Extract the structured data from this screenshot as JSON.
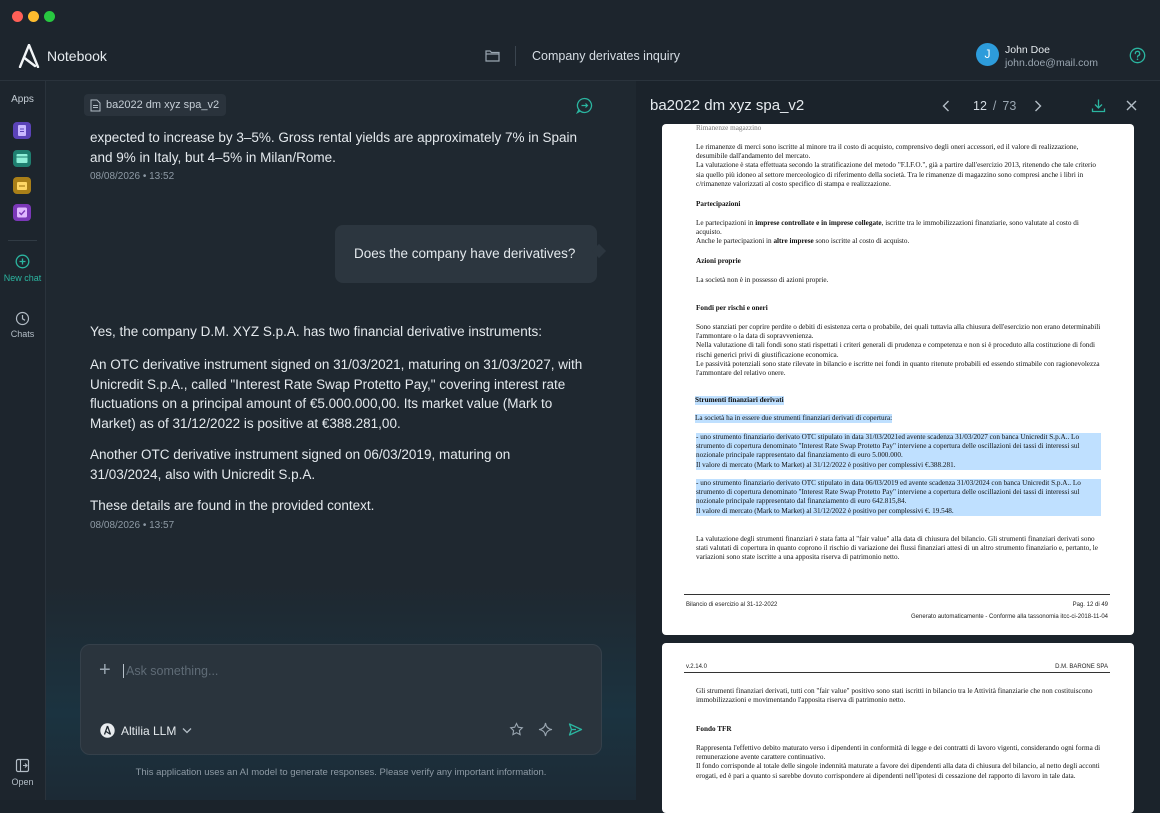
{
  "header": {
    "app_name": "Notebook",
    "document_title": "Company derivates inquiry",
    "user": {
      "initial": "J",
      "name": "John Doe",
      "email": "john.doe@mail.com"
    }
  },
  "sidebar": {
    "apps_label": "Apps",
    "new_chat_label": "New chat",
    "chats_label": "Chats",
    "open_label": "Open"
  },
  "chat": {
    "source_chip": "ba2022 dm xyz spa_v2",
    "messages": {
      "assistant_partial": "expected to increase by 3–5%. Gross rental yields are approximately 7% in Spain and 9% in Italy, but 4–5% in Milan/Rome.",
      "assistant_partial_time": "08/08/2026 • 13:52",
      "user_question": "Does the company have derivatives?",
      "answer_intro": "Yes, the company D.M. XYZ S.p.A. has two financial derivative instruments:",
      "answer_item1": " An OTC derivative instrument signed on 31/03/2021, maturing on 31/03/2027, with Unicredit S.p.A., called \"Interest Rate Swap Protetto Pay,\" covering interest rate fluctuations on a principal amount of €5.000.000,00. Its market value (Mark to Market) as of 31/12/2022 is positive at €388.281,00.",
      "answer_item2": "Another OTC derivative instrument signed on 06/03/2019, maturing on 31/03/2024, also with Unicredit S.p.A.",
      "answer_outro": "These details are found in the provided context.",
      "answer_time": "08/08/2026 • 13:57"
    },
    "input_placeholder": "Ask something...",
    "model_name": "Altilia LLM",
    "disclaimer": "This application uses an AI model to generate responses. Please verify any important information."
  },
  "document": {
    "title": "ba2022 dm xyz spa_v2",
    "current_page": "12",
    "page_separator": "/",
    "total_pages": "73",
    "page1": {
      "top_cut": "Rimanenze magazzino",
      "rimanenze": "Le rimanenze di merci sono iscritte al minore tra il costo di acquisto, comprensivo degli oneri accessori, ed il valore di realizzazione, desumibile dall'andamento del mercato.",
      "rimanenze2": "La valutazione è stata effettuata secondo la stratificazione del metodo \"F.I.F.O.\", già a partire dall'esercizio 2013, ritenendo che tale criterio sia quello più idoneo al settore merceologico di riferimento della società. Tra le rimanenze di magazzino sono compresi anche i libri in c/rimanenze valorizzati al costo specifico di stampa e realizzazione.",
      "partecipazioni_h": "Partecipazioni",
      "partecipazioni_a": "Le partecipazioni in ",
      "partecipazioni_b": "imprese controllate e in imprese collegate",
      "partecipazioni_c": ", iscritte tra le immobilizzazioni finanziarie, sono valutate al costo di acquisto.",
      "partecipazioni2_a": "Anche le partecipazioni in ",
      "partecipazioni2_b": "altre imprese",
      "partecipazioni2_c": " sono iscritte al costo di acquisto.",
      "azioni_h": "Azioni proprie",
      "azioni": "La società non è in possesso di azioni proprie.",
      "fondi_h": "Fondi per rischi e oneri",
      "fondi1": "Sono stanziati per coprire perdite o debiti di esistenza certa o probabile, dei quali tuttavia alla chiusura dell'esercizio non erano determinabili l'ammontare o la data di sopravvenienza.",
      "fondi2": "Nella valutazione di tali fondi sono stati rispettati i criteri generali di prudenza e competenza e non si è proceduto alla costituzione di fondi rischi generici privi di giustificazione economica.",
      "fondi3": "Le passività potenziali sono state rilevate in bilancio e iscritte nei fondi in quanto ritenute probabili ed essendo stimabile con ragionevolezza l'ammontare del relativo onere.",
      "strumenti_h": "Strumenti finanziari derivati",
      "strumenti_intro": "La società ha  in essere due strumenti finanziari derivati di copertura:",
      "strumento1": "- uno strumento finanziario derivato OTC stipulato in data 31/03/2021ed avente scadenza 31/03/2027 con banca Unicredit S.p.A.. Lo strumento di copertura denominato \"Interest Rate Swap Protetto Pay\" interviene a copertura delle oscillazioni dei tassi di interessi sul nozionale principale rappresentato dal finanziamento di euro 5.000.000.",
      "strumento1_mtm": "Il valore di mercato (Mark to Market) al 31/12/2022 è positivo per complessivi €.388.281.",
      "strumento2": "- uno strumento finanziario derivato OTC stipulato in data 06/03/2019 ed avente scadenza 31/03/2024 con banca Unicredit S.p.A.. Lo strumento di copertura denominato \"Interest Rate Swap Protetto Pay\" interviene a copertura delle oscillazioni dei tassi di interessi sul nozionale principale rappresentato dal finanziamento di euro 642.815,84.",
      "strumento2_mtm": "Il valore di mercato (Mark to Market) al 31/12/2022 è positivo per complessivi €. 19.548.",
      "valutazione": "La valutazione degli strumenti finanziari è stata fatta al \"fair value\" alla data di chiusura del bilancio. Gli strumenti finanziari derivati sono stati valutati di copertura in quanto coprono il rischio di variazione dei flussi finanziari attesi di un altro strumento finanziario e, pertanto, le variazioni sono state iscritte a una apposita riserva di patrimonio netto.",
      "footer_left": "Bilancio di esercizio al 31-12-2022",
      "footer_right": "Pag. 12 di 49",
      "footer_sub": "Generato automaticamente - Conforme alla tassonomia itcc-ci-2018-11-04"
    },
    "page2": {
      "header_left": "v.2.14.0",
      "header_right": "D.M. BARONE SPA",
      "p1": "Gli strumenti finanziari derivati, tutti  con \"fair value\" positivo sono stati iscritti in bilancio tra le Attività finanziarie che non costituiscono immobilizzazioni e  movimentando l'apposita riserva di patrimonio netto.",
      "tfr_h": "Fondo TFR",
      "tfr1": "Rappresenta l'effettivo debito maturato verso i dipendenti in conformità di legge e dei contratti di lavoro vigenti, considerando ogni forma di remunerazione avente carattere continuativo.",
      "tfr2": "Il fondo corrisponde al totale delle singole indennità maturate a favore dei dipendenti alla data di chiusura del bilancio, al netto degli acconti erogati, ed è pari a quanto si sarebbe dovuto corrispondere ai dipendenti nell'ipotesi di cessazione del rapporto di lavoro in tale data."
    }
  },
  "colors": {
    "accent_blue": "#2d9cdb",
    "highlight": "#bfe0ff",
    "app_icons": [
      "#7b5cd6",
      "#27a28c",
      "#d6a52b",
      "#9b4fd9"
    ]
  }
}
